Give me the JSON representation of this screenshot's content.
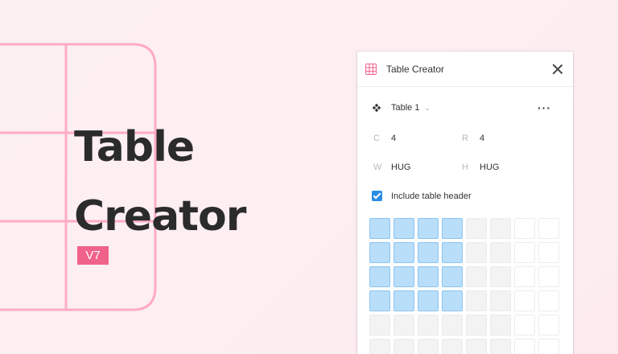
{
  "hero": {
    "title_line1": "Table",
    "title_line2": "Creator",
    "version": "V7"
  },
  "panel": {
    "title": "Table Creator",
    "table_name": "Table 1",
    "columns_label": "C",
    "columns_value": "4",
    "rows_label": "R",
    "rows_value": "4",
    "width_label": "W",
    "width_value": "HUG",
    "height_label": "H",
    "height_value": "HUG",
    "include_header_label": "Include table header",
    "include_header_checked": true
  },
  "grid_picker": {
    "selected_columns": 4,
    "selected_rows": 4,
    "visible_columns": 8,
    "visible_rows": 6
  },
  "colors": {
    "accent": "#f0628a",
    "checkbox": "#2a8de6",
    "selected_cell": "#b9defa"
  },
  "icons": {
    "header": "table-icon",
    "table_select": "component-icon",
    "close": "close-icon",
    "more": "more-icon"
  }
}
